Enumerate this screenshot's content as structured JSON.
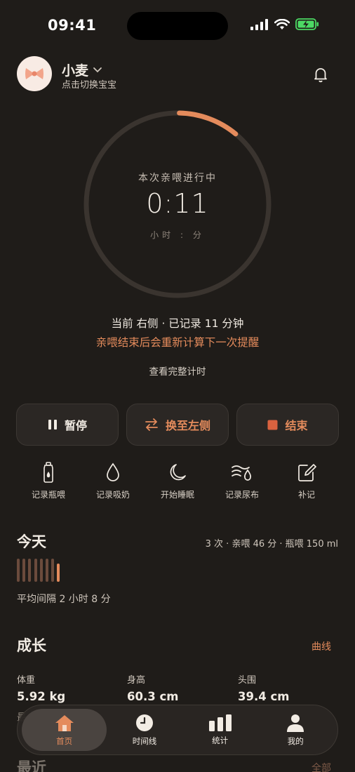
{
  "status_bar": {
    "time": "09:41"
  },
  "header": {
    "baby_name": "小麦",
    "switch_hint": "点击切换宝宝"
  },
  "timer": {
    "title": "本次亲喂进行中",
    "elapsed": "0:11",
    "unit": "小时 : 分",
    "progress": 0.11
  },
  "status": {
    "line": "当前 右侧 · 已记录 11 分钟",
    "reminder": "亲喂结束后会重新计算下一次提醒",
    "full_timer_link": "查看完整计时"
  },
  "actions": {
    "pause": "暂停",
    "switch_side": "换至左侧",
    "end": "结束"
  },
  "quick_actions": [
    {
      "label": "记录瓶喂",
      "icon": "bottle-icon"
    },
    {
      "label": "记录吸奶",
      "icon": "drop-icon"
    },
    {
      "label": "开始睡眠",
      "icon": "moon-icon"
    },
    {
      "label": "记录尿布",
      "icon": "diaper-icon"
    },
    {
      "label": "补记",
      "icon": "edit-icon"
    }
  ],
  "today": {
    "title": "今天",
    "summary": "3 次 · 亲喂 46 分 · 瓶喂 150 ml",
    "avg_interval": "平均间隔 2 小时 8 分"
  },
  "growth": {
    "title": "成长",
    "link": "曲线",
    "items": [
      {
        "label": "体重",
        "value": "5.92 kg"
      },
      {
        "label": "身高",
        "value": "60.3 cm"
      },
      {
        "label": "头围",
        "value": "39.4 cm"
      }
    ],
    "extra_partial": "最"
  },
  "recent": {
    "title": "最近",
    "link": "全部"
  },
  "tabbar": [
    {
      "label": "首页",
      "icon": "home-icon",
      "active": true
    },
    {
      "label": "时间线",
      "icon": "clock-icon",
      "active": false
    },
    {
      "label": "统计",
      "icon": "bar-chart-icon",
      "active": false
    },
    {
      "label": "我的",
      "icon": "person-icon",
      "active": false
    }
  ],
  "colors": {
    "background": "#1f1c19",
    "accent": "#e48b5c",
    "ring_track": "#3a342f"
  }
}
